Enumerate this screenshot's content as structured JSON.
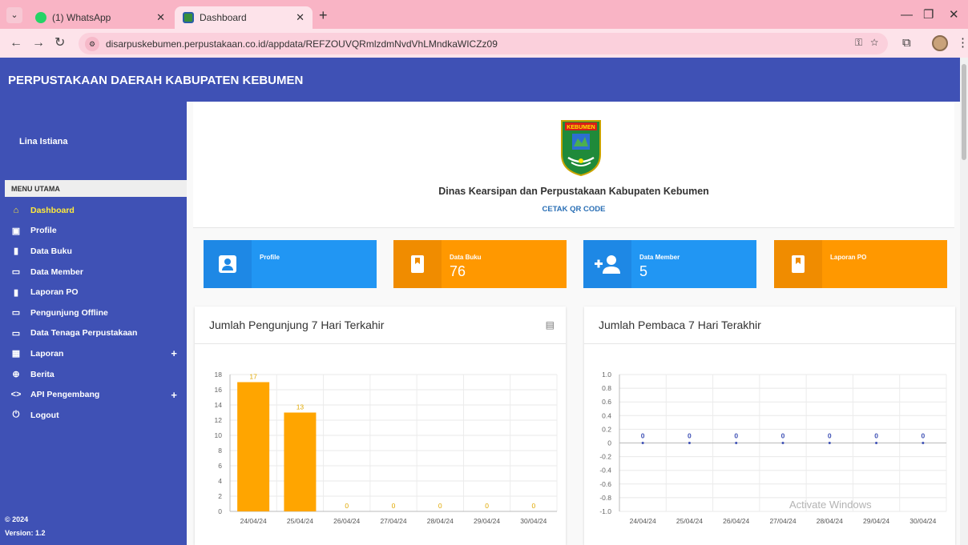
{
  "browser": {
    "tabs": [
      {
        "label": "(1) WhatsApp",
        "active": false
      },
      {
        "label": "Dashboard",
        "active": true
      }
    ],
    "url": "disarpuskebumen.perpustakaan.co.id/appdata/REFZOUVQRmlzdmNvdVhLMndkaWICZz09"
  },
  "app": {
    "title": "PERPUSTAKAAN DAERAH KABUPATEN KEBUMEN",
    "user": "Lina Istiana",
    "menu_header": "MENU UTAMA",
    "menu": [
      {
        "label": "Dashboard",
        "icon": "home-icon",
        "active": true
      },
      {
        "label": "Profile",
        "icon": "account-box-icon"
      },
      {
        "label": "Data Buku",
        "icon": "book-icon"
      },
      {
        "label": "Data Member",
        "icon": "folder-icon"
      },
      {
        "label": "Laporan PO",
        "icon": "book-icon"
      },
      {
        "label": "Pengunjung Offline",
        "icon": "folder-icon"
      },
      {
        "label": "Data Tenaga Perpustakaan",
        "icon": "folder-icon"
      },
      {
        "label": "Laporan",
        "icon": "grid-icon",
        "expandable": true
      },
      {
        "label": "Berita",
        "icon": "globe-icon"
      },
      {
        "label": "API Pengembang",
        "icon": "code-icon",
        "expandable": true
      },
      {
        "label": "Logout",
        "icon": "power-icon"
      }
    ],
    "footer": {
      "copyright": "© 2024",
      "version": "Version: 1.2"
    }
  },
  "header": {
    "org_name": "Dinas Kearsipan dan Perpustakaan Kabupaten Kebumen",
    "qr_label": "CETAK QR CODE",
    "logo_text": "KEBUMEN"
  },
  "stats": [
    {
      "label": "Profile",
      "value": "",
      "color": "#2196f3",
      "icon": "account-box-icon"
    },
    {
      "label": "Data Buku",
      "value": "76",
      "color": "#ff9800",
      "icon": "book-icon"
    },
    {
      "label": "Data Member",
      "value": "5",
      "color": "#2196f3",
      "icon": "add-user-icon"
    },
    {
      "label": "Laporan PO",
      "value": "",
      "color": "#ff9800",
      "icon": "book-icon"
    }
  ],
  "watermark": "Activate Windows",
  "chart_data": [
    {
      "type": "bar",
      "title": "Jumlah Pengunjung 7 Hari Terkahir",
      "categories": [
        "24/04/24",
        "25/04/24",
        "26/04/24",
        "27/04/24",
        "28/04/24",
        "29/04/24",
        "30/04/24"
      ],
      "values": [
        17,
        13,
        0,
        0,
        0,
        0,
        0
      ],
      "ylim": [
        0,
        18
      ],
      "yticks": [
        0,
        2,
        4,
        6,
        8,
        10,
        12,
        14,
        16,
        18
      ],
      "color": "#ffa500",
      "grid": true
    },
    {
      "type": "line",
      "title": "Jumlah Pembaca 7 Hari Terakhir",
      "categories": [
        "24/04/24",
        "25/04/24",
        "26/04/24",
        "27/04/24",
        "28/04/24",
        "29/04/24",
        "30/04/24"
      ],
      "values": [
        0,
        0,
        0,
        0,
        0,
        0,
        0
      ],
      "ylim": [
        -1.0,
        1.0
      ],
      "yticks": [
        -1.0,
        -0.8,
        -0.6,
        -0.4,
        -0.2,
        0,
        0.2,
        0.4,
        0.6,
        0.8,
        1.0
      ],
      "color": "#3f51b5",
      "grid": true
    }
  ]
}
